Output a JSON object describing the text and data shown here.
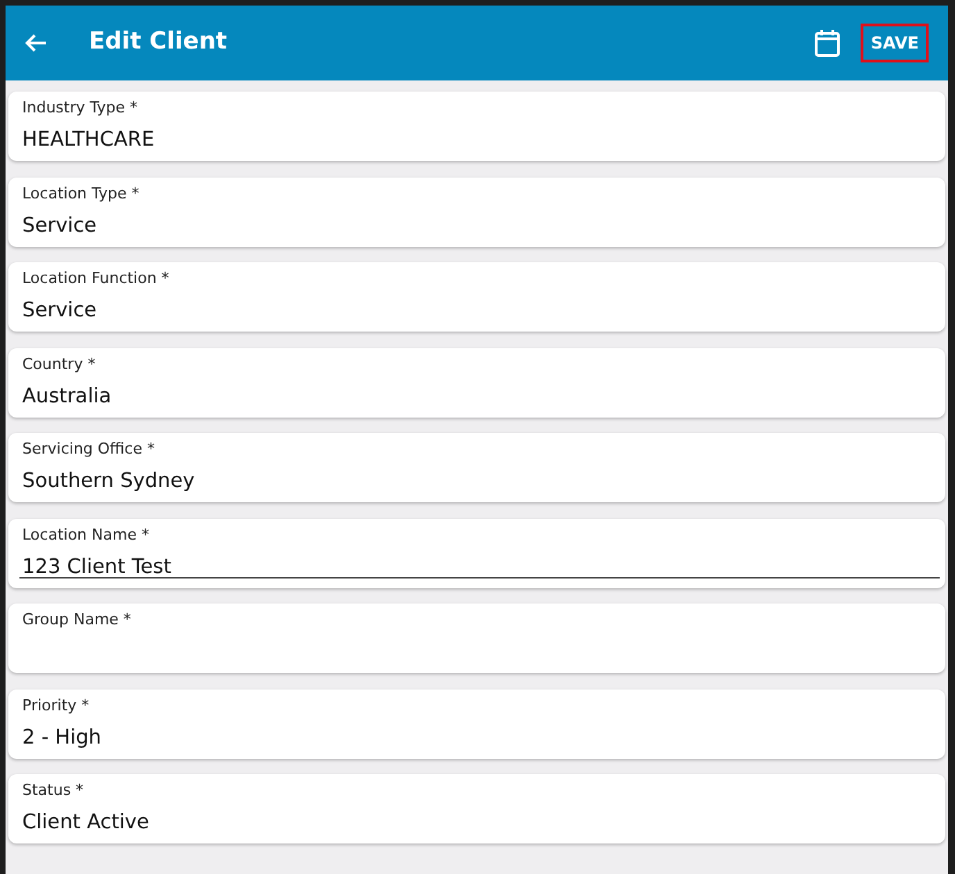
{
  "app_bar": {
    "title": "Edit Client",
    "save_button": {
      "label": "SAVE",
      "outlined": true
    }
  },
  "fields": [
    {
      "label": "Industry Type *",
      "value": "HEALTHCARE",
      "focused": false
    },
    {
      "label": "Location Type *",
      "value": "Service",
      "focused": false
    },
    {
      "label": "Location Function *",
      "value": "Service",
      "focused": false
    },
    {
      "label": "Country *",
      "value": "Australia",
      "focused": false
    },
    {
      "label": "Servicing Office *",
      "value": "Southern Sydney",
      "focused": false
    },
    {
      "label": "Location Name *",
      "value": "123 Client Test",
      "focused": true
    },
    {
      "label": "Group Name *",
      "focused": false
    },
    {
      "label": "Priority *",
      "value": "2 - High",
      "focused": false
    },
    {
      "label": "Status *",
      "value": "Client Active",
      "focused": false
    }
  ]
}
